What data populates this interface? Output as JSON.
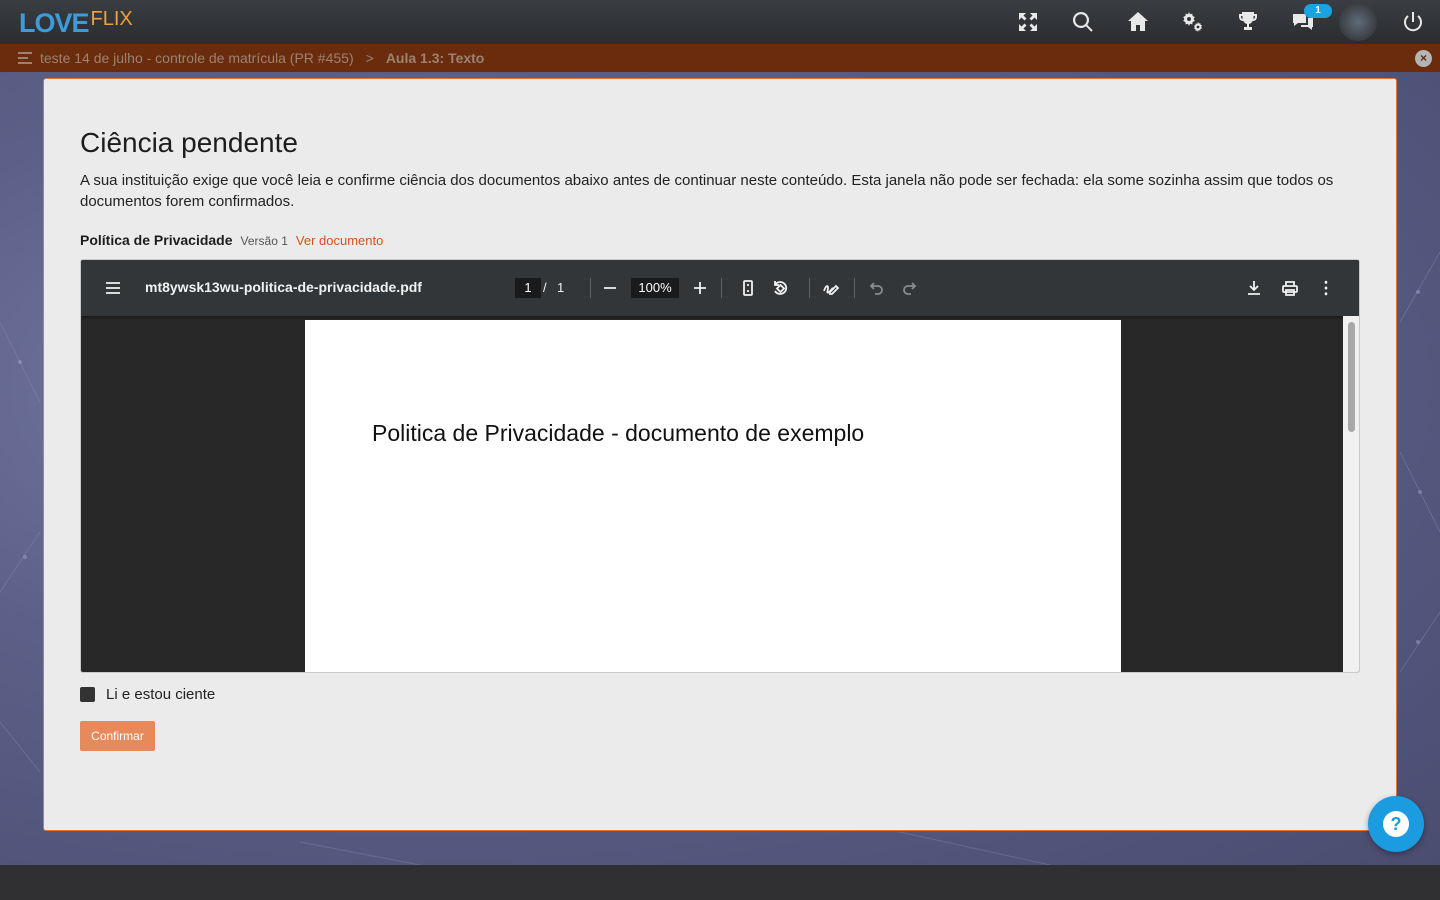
{
  "app": {
    "logo_love": "LOVE",
    "logo_flix": "FLIX",
    "notification_count": "1",
    "colors": {
      "brand_blue": "#3d9bd9",
      "brand_orange": "#f0a03c",
      "accent": "#d2541c",
      "confirm_button": "#e68a5b",
      "help_button": "#1b9be0"
    }
  },
  "nav": {
    "icons": [
      "fullscreen-icon",
      "search-icon",
      "home-icon",
      "gears-icon",
      "trophy-icon",
      "chat-icon",
      "avatar",
      "power-icon"
    ]
  },
  "breadcrumb": {
    "course": "teste 14 de julho - controle de matrícula (PR #455)",
    "separator": ">",
    "lesson": "Aula 1.3: Texto",
    "close": "×"
  },
  "modal": {
    "title": "Ciência pendente",
    "description": "A sua instituição exige que você leia e confirme ciência dos documentos abaixo antes de continuar neste conteúdo. Esta janela não pode ser fechada: ela some sozinha assim que todos os documentos forem confirmados.",
    "document": {
      "name": "Política de Privacidade",
      "version": "Versão 1",
      "link": "Ver documento"
    },
    "pdf": {
      "filename": "mt8ywsk13wu-politica-de-privacidade.pdf",
      "current_page": "1",
      "page_separator": "/",
      "total_pages": "1",
      "zoom": "100%",
      "page_text": "Politica de Privacidade - documento de exemplo"
    },
    "ack_label": "Li e estou ciente",
    "confirm_label": "Confirmar"
  },
  "help": {
    "label": "?"
  }
}
